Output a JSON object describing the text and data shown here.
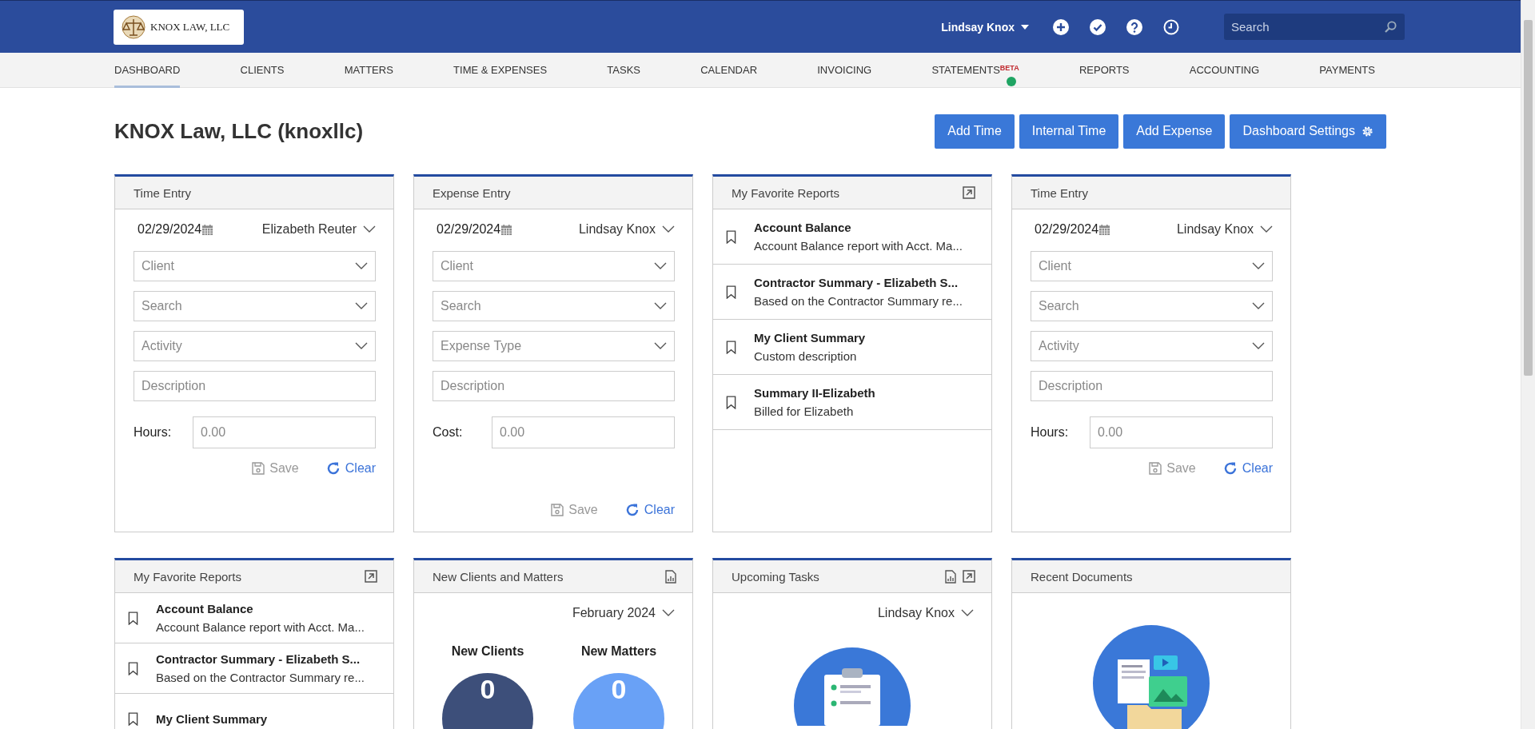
{
  "header": {
    "logo_text": "KNOX LAW, LLC",
    "user": "Lindsay Knox",
    "search": {
      "placeholder": "Search"
    }
  },
  "nav": [
    {
      "label": "DASHBOARD",
      "selected": true,
      "new_dot": false
    },
    {
      "label": "CLIENTS",
      "selected": false,
      "new_dot": false
    },
    {
      "label": "MATTERS",
      "selected": false,
      "new_dot": false
    },
    {
      "label": "TIME & EXPENSES",
      "selected": false,
      "new_dot": false
    },
    {
      "label": "TASKS",
      "selected": false,
      "new_dot": false
    },
    {
      "label": "CALENDAR",
      "selected": false,
      "new_dot": false
    },
    {
      "label": "INVOICING",
      "selected": false,
      "new_dot": false
    },
    {
      "label": "STATEMENTS",
      "badge": "BETA",
      "selected": false,
      "new_dot": true
    },
    {
      "label": "REPORTS",
      "selected": false,
      "new_dot": false
    },
    {
      "label": "ACCOUNTING",
      "selected": false,
      "new_dot": false
    },
    {
      "label": "PAYMENTS",
      "selected": false,
      "new_dot": false
    }
  ],
  "page_title": "KNOX Law, LLC (knoxllc)",
  "actions": [
    {
      "label": "Add Time",
      "kind": "plain"
    },
    {
      "label": "Internal Time",
      "kind": "plain"
    },
    {
      "label": "Add Expense",
      "kind": "plain"
    },
    {
      "label": "Dashboard Settings",
      "kind": "settings"
    }
  ],
  "widget_rows": [
    [
      {
        "kind": "entry",
        "title": "Time Entry",
        "export_icon": false,
        "report_icon": false,
        "date": "02/29/2024",
        "user": "Elizabeth Reuter",
        "selects": [
          "Client",
          "Search",
          "Activity"
        ],
        "description": "Description",
        "amount_label": "Hours:",
        "amount_placeholder": "0.00",
        "save": "Save",
        "clear": "Clear"
      },
      {
        "kind": "entry",
        "title": "Expense Entry",
        "export_icon": false,
        "report_icon": false,
        "date": "02/29/2024",
        "user": "Lindsay Knox",
        "selects": [
          "Client",
          "Search",
          "Expense Type"
        ],
        "description": "Description",
        "amount_label": "Cost:",
        "amount_placeholder": "0.00",
        "save": "Save",
        "clear": "Clear"
      },
      {
        "kind": "reports",
        "title": "My Favorite Reports",
        "export_icon": true,
        "report_icon": false,
        "reports": [
          {
            "name": "Account Balance",
            "description": "Account Balance report with Acct. Ma..."
          },
          {
            "name": "Contractor Summary - Elizabeth S...",
            "description": "Based on the Contractor Summary re..."
          },
          {
            "name": "My Client Summary",
            "description": "Custom description"
          },
          {
            "name": "Summary II-Elizabeth",
            "description": "Billed for Elizabeth"
          }
        ]
      },
      {
        "kind": "entry",
        "title": "Time Entry",
        "export_icon": false,
        "report_icon": false,
        "date": "02/29/2024",
        "user": "Lindsay Knox",
        "selects": [
          "Client",
          "Search",
          "Activity"
        ],
        "description": "Description",
        "amount_label": "Hours:",
        "amount_placeholder": "0.00",
        "save": "Save",
        "clear": "Clear"
      }
    ],
    [
      {
        "kind": "reports",
        "title": "My Favorite Reports",
        "export_icon": true,
        "report_icon": false,
        "reports": [
          {
            "name": "Account Balance",
            "description": "Account Balance report with Acct. Ma..."
          },
          {
            "name": "Contractor Summary - Elizabeth S...",
            "description": "Based on the Contractor Summary re..."
          },
          {
            "name": "My Client Summary"
          }
        ]
      },
      {
        "kind": "stats",
        "title": "New Clients and Matters",
        "export_icon": false,
        "report_icon": true,
        "period": "February 2024",
        "stats": [
          {
            "label": "New Clients",
            "value": "0",
            "color": "#3d4f7a"
          },
          {
            "label": "New Matters",
            "value": "0",
            "color": "#69a1f6"
          }
        ]
      },
      {
        "kind": "tasks",
        "title": "Upcoming Tasks",
        "export_icon": true,
        "report_icon": true,
        "user": "Lindsay Knox"
      },
      {
        "kind": "documents",
        "title": "Recent Documents",
        "export_icon": false,
        "report_icon": false
      }
    ]
  ]
}
